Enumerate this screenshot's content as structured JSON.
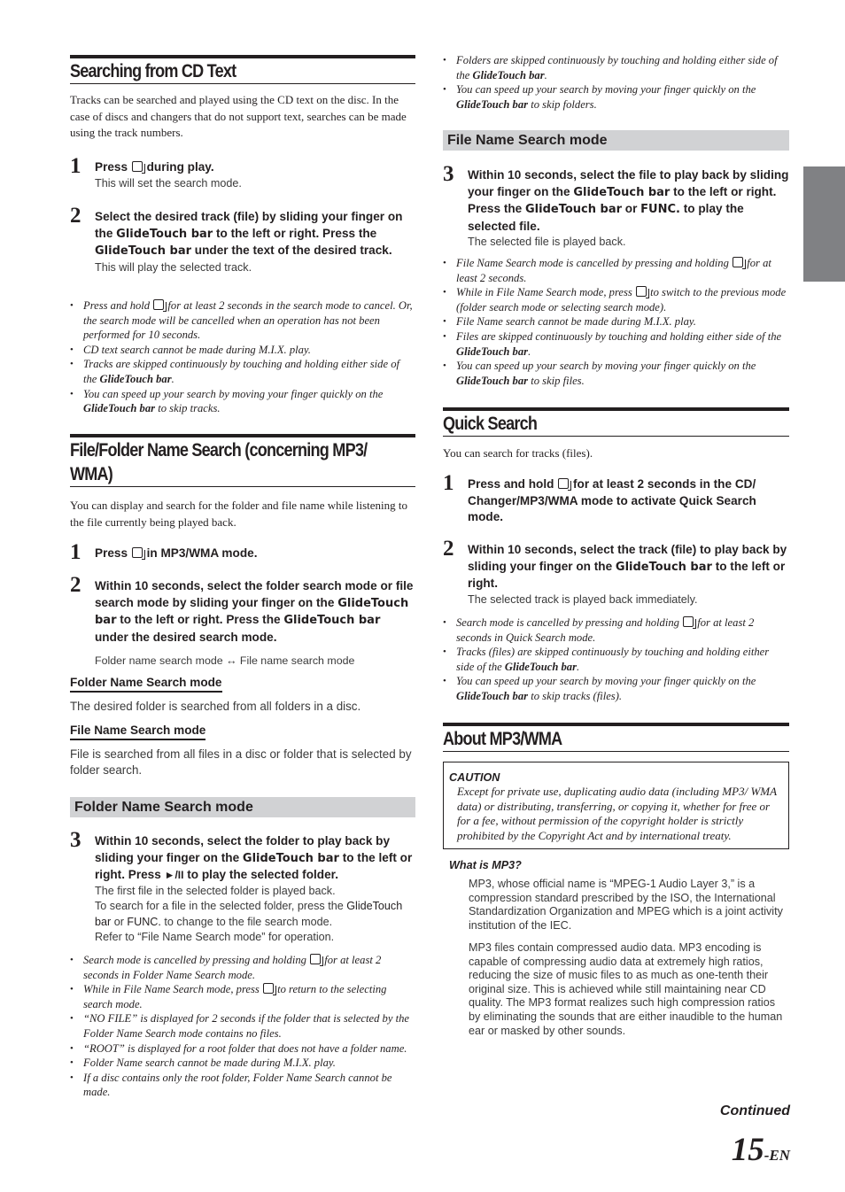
{
  "left": {
    "cd_text": {
      "heading": "Searching from CD Text",
      "intro": "Tracks can be searched and played using the CD text on the disc. In the case of discs and changers that do not support text, searches can be made using the track numbers.",
      "step1": {
        "num": "1",
        "pre": "Press",
        "post": "during play.",
        "note": "This will set the search mode."
      },
      "step2": {
        "num": "2",
        "t1": "Select the desired track (file) by sliding your finger on the",
        "b1": "GlideTouch bar",
        "t2": "to the left or right. Press the",
        "b2": "GlideTouch bar",
        "t3": "under the text of the desired track.",
        "note": "This will play the selected track."
      },
      "bullets": {
        "b1a": "Press and hold",
        "b1b": "for at least 2 seconds in the search mode to cancel. Or, the search mode will be cancelled when an operation has not been performed for 10 seconds.",
        "b2": "CD text search cannot be made during M.I.X. play.",
        "b3a": "Tracks are skipped continuously by touching and holding either side of the",
        "b3b": "GlideTouch bar",
        "b3c": ".",
        "b4a": "You can speed up your search by moving your finger quickly on the",
        "b4b": "GlideTouch bar",
        "b4c": "to skip tracks."
      }
    },
    "file_folder": {
      "heading_line1": "File/Folder Name Search (concerning MP3/",
      "heading_line2": "WMA)",
      "intro": "You can display and search for the folder and file name while listening to the file currently being played back.",
      "step1": {
        "num": "1",
        "pre": "Press",
        "post": "in MP3/WMA mode."
      },
      "step2": {
        "num": "2",
        "t1": "Within 10 seconds, select the folder search mode or file search mode by sliding your finger on the",
        "b1": "GlideTouch bar",
        "t2": "to the left or right. Press the",
        "b2": "GlideTouch bar",
        "t3": "under the desired search mode.",
        "cycle": "Folder name search mode ↔ File name search mode"
      },
      "folder_mode_head": "Folder Name Search mode",
      "folder_mode_desc": "The desired folder is searched from all folders in a disc.",
      "file_mode_head": "File Name Search mode",
      "file_mode_desc": "File is searched from all files in a disc or folder that is selected by folder search.",
      "band": "Folder Name Search mode",
      "step3": {
        "num": "3",
        "t1": "Within 10 seconds, select the folder to play back by sliding your finger on the",
        "b1": "GlideTouch bar",
        "t2": "to the left or right. Press",
        "t3": "to play the selected folder.",
        "n1": "The first file in the selected folder is played back.",
        "n2": "To search for a file in the selected folder, press the",
        "n2b": "GlideTouch bar",
        "n2c": "or",
        "n2d": "FUNC.",
        "n2e": "to change to the file search mode.",
        "n3": "Refer to “File Name Search mode” for operation."
      },
      "bullets": {
        "b1a": "Search mode is cancelled by pressing and holding",
        "b1b": "for at least 2 seconds in Folder Name Search mode.",
        "b2a": "While in File Name Search mode, press",
        "b2b": "to return to the selecting search mode.",
        "b3": "“NO FILE” is displayed for 2 seconds if the folder that is selected by the Folder Name Search mode contains no files.",
        "b4": "“ROOT” is displayed for a root folder that does not have a folder name.",
        "b5": "Folder Name search cannot be made during M.I.X. play.",
        "b6": "If a disc contains only the root  folder, Folder Name Search cannot be made."
      }
    }
  },
  "right": {
    "top_bullets": {
      "b1a": "Folders are skipped continuously by touching and holding either side of the",
      "b1b": "GlideTouch bar",
      "b1c": ".",
      "b2a": "You can speed up your search by moving your finger quickly on the",
      "b2b": "GlideTouch bar",
      "b2c": "to skip folders."
    },
    "band": "File Name Search mode",
    "step3": {
      "num": "3",
      "t1": "Within 10 seconds, select the file to play back by sliding your finger on the",
      "b1": "GlideTouch bar",
      "t2": "to the left or right. Press the",
      "b2": "GlideTouch bar",
      "t3": "or",
      "b3": "FUNC.",
      "t4": "to play the selected file.",
      "note": "The selected file is played back."
    },
    "file_bullets": {
      "b1a": "File Name Search mode is cancelled by pressing and holding",
      "b1b": "for at least 2 seconds.",
      "b2a": "While in File Name Search mode, press",
      "b2b": "to switch to the previous mode (folder search mode or selecting search mode).",
      "b3": "File Name search cannot be made during M.I.X. play.",
      "b4a": "Files are skipped continuously by touching and holding either side of the",
      "b4b": "GlideTouch bar",
      "b4c": ".",
      "b5a": "You can speed up your search by moving your finger quickly on the",
      "b5b": "GlideTouch bar",
      "b5c": "to skip files."
    },
    "quick": {
      "heading": "Quick Search",
      "intro": "You can search for tracks (files).",
      "step1": {
        "num": "1",
        "pre": "Press and hold",
        "post": "for at least 2 seconds in the CD/ Changer/MP3/WMA mode to activate Quick Search mode."
      },
      "step2": {
        "num": "2",
        "t1": "Within 10 seconds, select the track (file) to play back by sliding your finger on the",
        "b1": "GlideTouch bar",
        "t2": "to the left or right.",
        "note": "The selected track is played back immediately."
      },
      "bullets": {
        "b1a": "Search mode is cancelled by pressing and holding",
        "b1b": "for at least 2 seconds in Quick Search mode.",
        "b2a": "Tracks (files) are skipped continuously by touching and holding either side of the",
        "b2b": "GlideTouch bar",
        "b2c": ".",
        "b3a": "You can speed up your search by moving your finger quickly on the",
        "b3b": "GlideTouch bar",
        "b3c": "to skip tracks (files)."
      }
    },
    "about": {
      "heading": "About MP3/WMA",
      "caution_title": "CAUTION",
      "caution_body": "Except for private use, duplicating audio data (including MP3/ WMA data) or distributing, transferring, or copying it, whether for free or for a fee, without permission of the copyright holder is strictly prohibited by the Copyright Act and by international treaty.",
      "what_is": "What is MP3?",
      "p1": "MP3, whose official name is “MPEG-1 Audio Layer 3,” is a compression standard prescribed by the ISO, the International Standardization Organization and MPEG which is a joint activity institution of the IEC.",
      "p2": "MP3 files contain compressed audio data. MP3 encoding is capable of compressing audio data at extremely high ratios, reducing the size of music files to as much as one-tenth their original size. This is achieved while still maintaining near CD quality. The MP3 format realizes such high compression ratios by eliminating the sounds that are either inaudible to the human ear or masked by other sounds."
    }
  },
  "footer": {
    "continued": "Continued",
    "page_number": "15",
    "page_suffix": "-EN"
  },
  "colors": {
    "text": "#231f20",
    "band": "#d1d2d4",
    "side_tab": "#808184"
  }
}
